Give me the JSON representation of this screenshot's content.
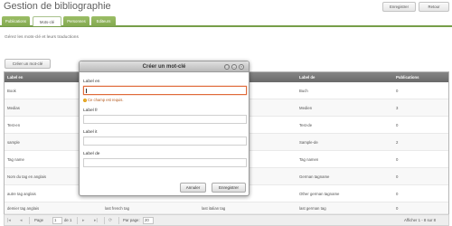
{
  "header": {
    "title": "Gestion de bibliographie",
    "save_label": "Enregistrer",
    "back_label": "Retour"
  },
  "tabs": [
    {
      "label": "Publications"
    },
    {
      "label": "Mots-clé"
    },
    {
      "label": "Personnes"
    },
    {
      "label": "Editeurs"
    }
  ],
  "subtitle": "Gérez les mots-clé et leurs traductions",
  "create_button": "Créer un mot-clé",
  "grid": {
    "columns": [
      "Label en",
      "",
      "",
      "Label de",
      "Publications"
    ],
    "rows": [
      {
        "en": "Book",
        "fr": "",
        "it": "",
        "de": "Buch",
        "pubs": "0"
      },
      {
        "en": "Medias",
        "fr": "",
        "it": "",
        "de": "Medien",
        "pubs": "3"
      },
      {
        "en": "Test-en",
        "fr": "",
        "it": "",
        "de": "Test-de",
        "pubs": "0"
      },
      {
        "en": "sample",
        "fr": "",
        "it": "",
        "de": "Sample-de",
        "pubs": "2"
      },
      {
        "en": "Tag name",
        "fr": "",
        "it": "",
        "de": "Tag namen",
        "pubs": "0"
      },
      {
        "en": "Nom du tag en anglais",
        "fr": "",
        "it": "",
        "de": "German tagname",
        "pubs": "0"
      },
      {
        "en": "autre tag anglais",
        "fr": "",
        "it": "",
        "de": "Other german tagname",
        "pubs": "0"
      },
      {
        "en": "demier tag anglais",
        "fr": "last french tag",
        "it": "last italian tag",
        "de": "last german tag",
        "pubs": "0"
      }
    ]
  },
  "pager": {
    "page_label": "Page",
    "page_value": "1",
    "of_label": "de 1",
    "per_page_label": "Par page:",
    "per_page_value": "20",
    "summary": "Afficher 1 - 8 sur 8"
  },
  "dialog": {
    "title": "Créer un mot-clé",
    "fields": [
      {
        "label": "Label en",
        "value": ""
      },
      {
        "label": "Label fr",
        "value": ""
      },
      {
        "label": "Label it",
        "value": ""
      },
      {
        "label": "Label de",
        "value": ""
      }
    ],
    "error": "Ce champ est requis.",
    "cancel_label": "Annuler",
    "save_label": "Enregistrer"
  },
  "colors": {
    "tab_green": "#7aa63c",
    "error_orange": "#e06a3a",
    "grid_header": "#5c5c5c"
  }
}
